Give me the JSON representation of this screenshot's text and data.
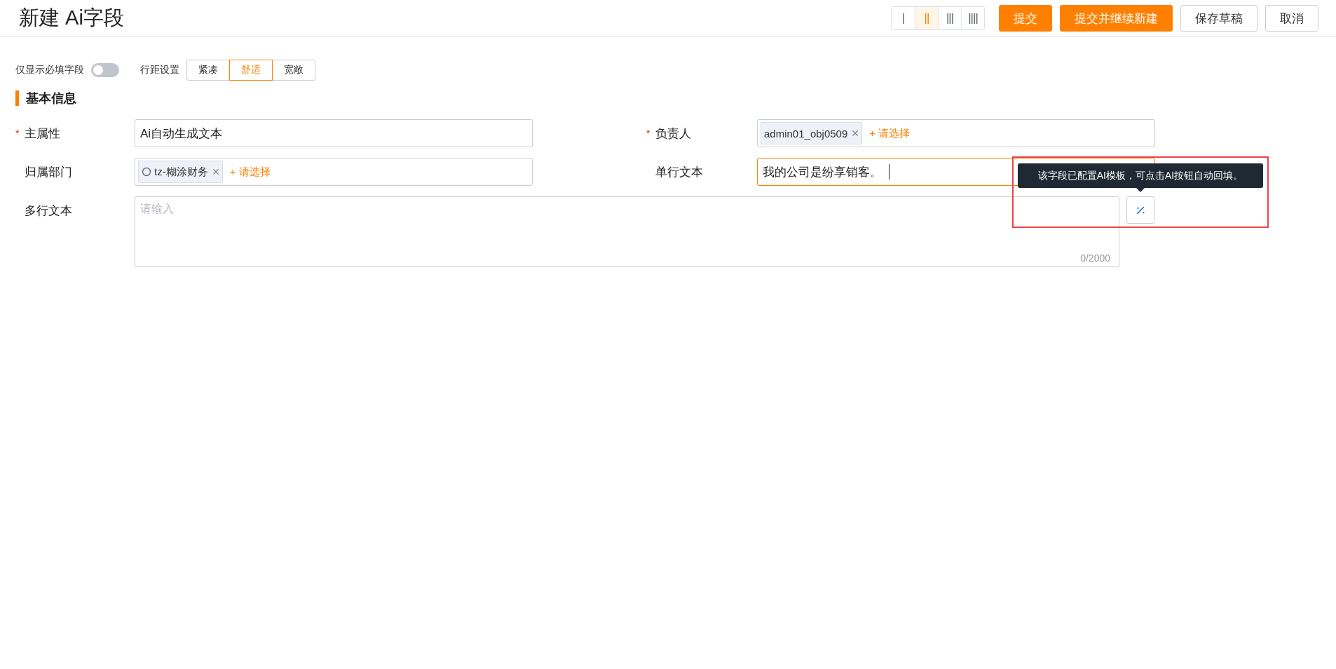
{
  "page": {
    "title": "新建 Ai字段"
  },
  "column_layouts": [
    {
      "label": "|",
      "selected": false
    },
    {
      "label": "||",
      "selected": true
    },
    {
      "label": "|||",
      "selected": false
    },
    {
      "label": "||||",
      "selected": false
    }
  ],
  "actions": [
    {
      "label": "提交",
      "kind": "primary"
    },
    {
      "label": "提交并继续新建",
      "kind": "primary"
    },
    {
      "label": "保存草稿",
      "kind": "default"
    },
    {
      "label": "取消",
      "kind": "default"
    }
  ],
  "required_only": {
    "label": "仅显示必填字段",
    "on": false
  },
  "row_spacing": {
    "label": "行距设置",
    "options": [
      {
        "label": "紧凑",
        "selected": false
      },
      {
        "label": "舒适",
        "selected": true
      },
      {
        "label": "宽敞",
        "selected": false
      }
    ]
  },
  "section": {
    "title": "基本信息"
  },
  "fields": [
    {
      "label": "主属性",
      "required_mark": "*",
      "kind": "text",
      "value": "Ai自动生成文本",
      "focused": false
    },
    {
      "label": "负责人",
      "required_mark": "*",
      "kind": "select",
      "tags": [
        {
          "label": "admin01_obj0509",
          "kind": "user"
        }
      ],
      "add_label": "+ 请选择"
    },
    {
      "label": "归属部门",
      "kind": "select",
      "tags": [
        {
          "label": "tz-糊涂财务",
          "kind": "department"
        }
      ],
      "add_label": "+ 请选择"
    },
    {
      "label": "单行文本",
      "kind": "text",
      "value": "我的公司是纷享销客。",
      "focused": true
    },
    {
      "label": "多行文本",
      "kind": "textarea",
      "placeholder": "请输入",
      "counter": "0/2000",
      "tooltip": "该字段已配置AI模板，可点击AI按钮自动回填。"
    }
  ]
}
